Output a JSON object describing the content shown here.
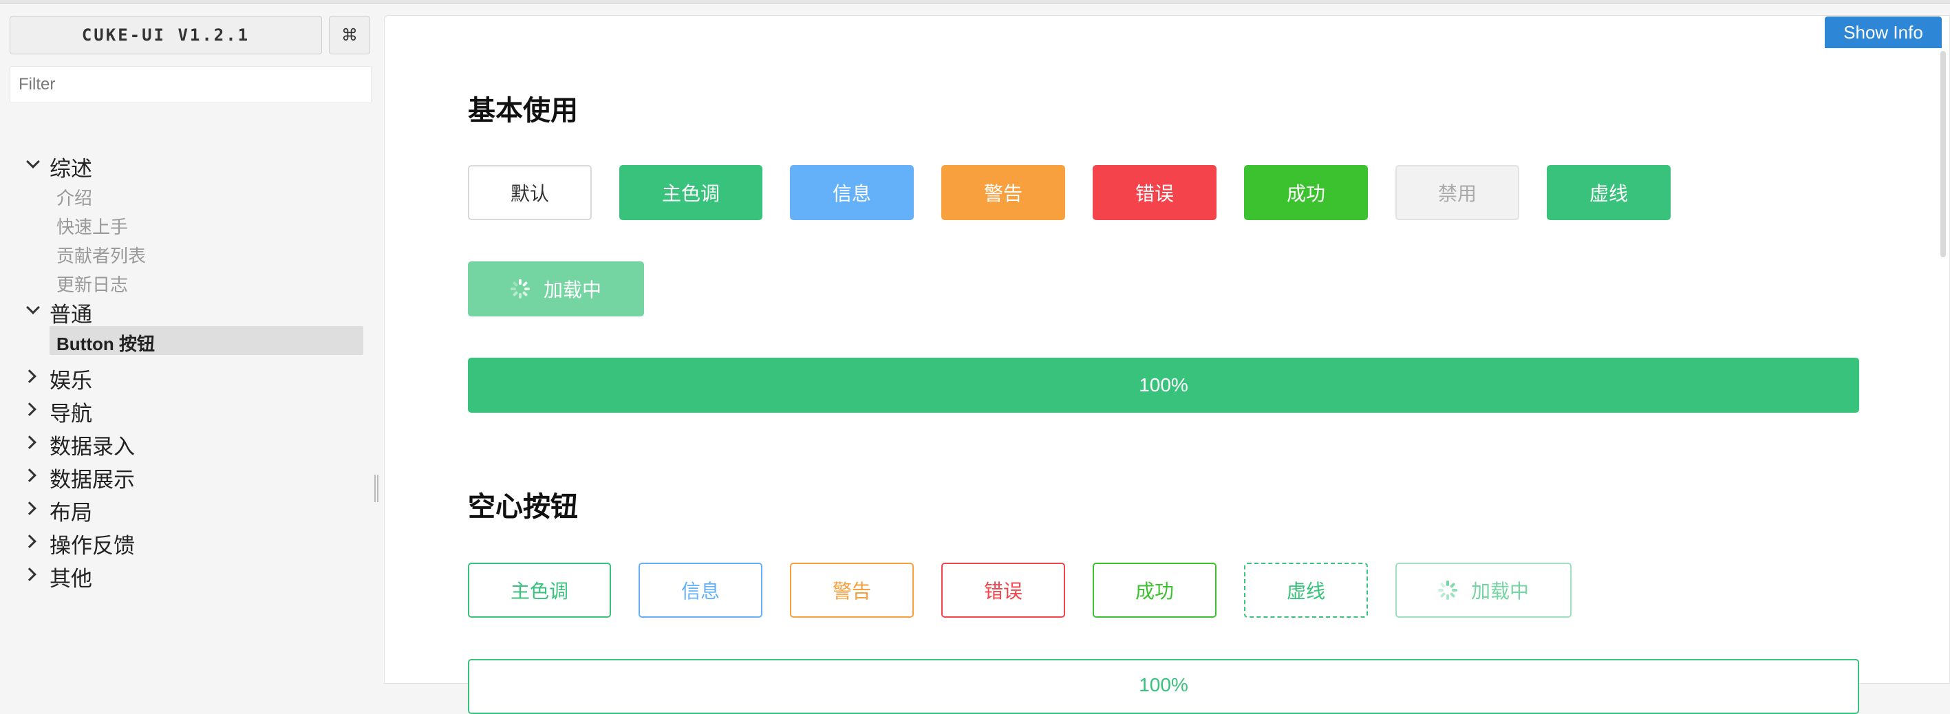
{
  "sidebar": {
    "app_title": "CUKE-UI V1.2.1",
    "cmd_symbol": "⌘",
    "filter_placeholder": "Filter",
    "groups": [
      {
        "label": "综述",
        "expanded": true,
        "children": [
          "介绍",
          "快速上手",
          "贡献者列表",
          "更新日志"
        ]
      },
      {
        "label": "普通",
        "expanded": true,
        "children": [
          "Button 按钮"
        ],
        "active_child": "Button 按钮"
      },
      {
        "label": "娱乐",
        "expanded": false
      },
      {
        "label": "导航",
        "expanded": false
      },
      {
        "label": "数据录入",
        "expanded": false
      },
      {
        "label": "数据展示",
        "expanded": false
      },
      {
        "label": "布局",
        "expanded": false
      },
      {
        "label": "操作反馈",
        "expanded": false
      },
      {
        "label": "其他",
        "expanded": false
      }
    ]
  },
  "header": {
    "show_info_label": "Show Info"
  },
  "sections": [
    {
      "title": "基本使用",
      "buttons": [
        {
          "label": "默认",
          "variant": "default"
        },
        {
          "label": "主色调",
          "variant": "primary"
        },
        {
          "label": "信息",
          "variant": "info"
        },
        {
          "label": "警告",
          "variant": "warning"
        },
        {
          "label": "错误",
          "variant": "error"
        },
        {
          "label": "成功",
          "variant": "success"
        },
        {
          "label": "禁用",
          "variant": "disabled"
        },
        {
          "label": "虚线",
          "variant": "dashed"
        },
        {
          "label": "加载中",
          "variant": "loading"
        }
      ],
      "block_button_label": "100%"
    },
    {
      "title": "空心按钮",
      "buttons": [
        {
          "label": "主色调",
          "variant": "primary"
        },
        {
          "label": "信息",
          "variant": "info"
        },
        {
          "label": "警告",
          "variant": "warning"
        },
        {
          "label": "错误",
          "variant": "error"
        },
        {
          "label": "成功",
          "variant": "success"
        },
        {
          "label": "虚线",
          "variant": "dashed"
        },
        {
          "label": "加载中",
          "variant": "loading"
        }
      ],
      "block_button_label": "100%"
    }
  ],
  "colors": {
    "primary": "#38c27b",
    "info": "#64b1fa",
    "warning": "#f8a03e",
    "error": "#f5434c",
    "success": "#3cc22f",
    "show_info": "#2d87d6"
  }
}
